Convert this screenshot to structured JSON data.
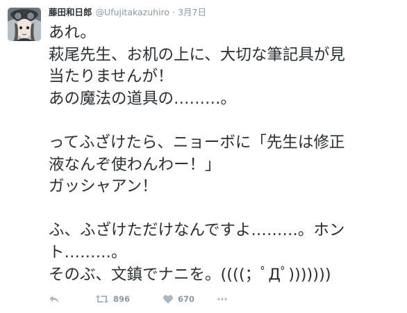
{
  "tweet": {
    "author_name": "藤田和日郎",
    "author_handle": "@Ufujitakazuhiro",
    "separator": "·",
    "timestamp": "3月7日",
    "text_lines": [
      "あれ。",
      "萩尾先生、お机の上に、大切な筆記具が見",
      "当たりませんが！",
      "あの魔法の道具の………。",
      "",
      "ってふざけたら、ニョーボに「先生は修正",
      "液なんぞ使わんわー！」",
      "ガッシャアン！",
      "",
      "ふ、ふざけただけなんですよ………。ホン",
      "ト………。",
      "そのぶ、文鎮でナニを。((((；ﾟДﾟ)))))))"
    ]
  },
  "actions": {
    "reply": {
      "icon": "reply-icon"
    },
    "retweet": {
      "icon": "retweet-icon",
      "count": "896"
    },
    "like": {
      "icon": "heart-icon",
      "count": "670"
    },
    "more": {
      "icon": "more-icon"
    }
  },
  "colors": {
    "text": "#292f33",
    "secondary": "#8899a6",
    "icon": "#aab8c2"
  }
}
